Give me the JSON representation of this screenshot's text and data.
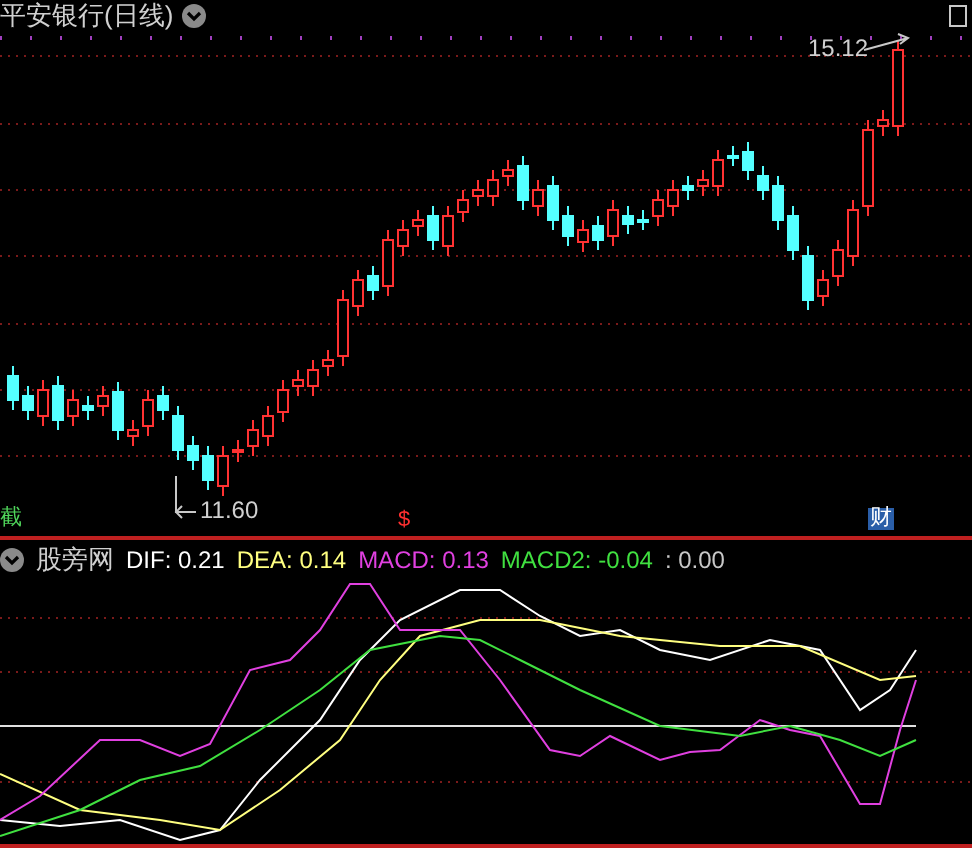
{
  "price_panel": {
    "title": "平安银行(日线)",
    "high_label": "15.12",
    "low_label": "11.60",
    "markers": [
      {
        "text": "截",
        "color": "#4fd45a"
      },
      {
        "text": "$",
        "color": "#ff3030"
      },
      {
        "text": "财",
        "color": "#2a5ea8"
      }
    ]
  },
  "indicator_panel": {
    "name": "股旁网",
    "values": [
      {
        "text": "DIF: 0.21",
        "color": "#ffffff"
      },
      {
        "text": "DEA: 0.14",
        "color": "#ffff80"
      },
      {
        "text": "MACD: 0.13",
        "color": "#e040e0"
      },
      {
        "text": "MACD2: -0.04",
        "color": "#40e040"
      },
      {
        "text": ": 0.00",
        "color": "#c8c8c8"
      }
    ]
  }
}
